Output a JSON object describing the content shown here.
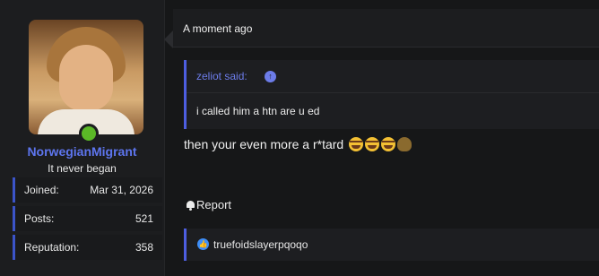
{
  "user": {
    "username": "NorwegianMigrant",
    "title": "It never began",
    "online_color": "#5bb827",
    "stats": [
      {
        "label": "Joined:",
        "value": "Mar 31, 2026"
      },
      {
        "label": "Posts:",
        "value": "521"
      },
      {
        "label": "Reputation:",
        "value": "358"
      }
    ]
  },
  "post": {
    "time": "A moment ago",
    "quote": {
      "author": "zeliot said:",
      "text": "i called him a htn are u ed"
    },
    "body": "then your even more a r*tard",
    "emojis": [
      "rolling-laughing",
      "rolling-laughing",
      "rolling-laughing",
      "poop"
    ],
    "report_label": "Report",
    "reactions": {
      "icon": "like-icon",
      "users": "truefoidslayerpqoqo"
    }
  },
  "colors": {
    "accent": "#5d75ee",
    "quote_border": "#4d5ee0",
    "background": "#161718"
  }
}
